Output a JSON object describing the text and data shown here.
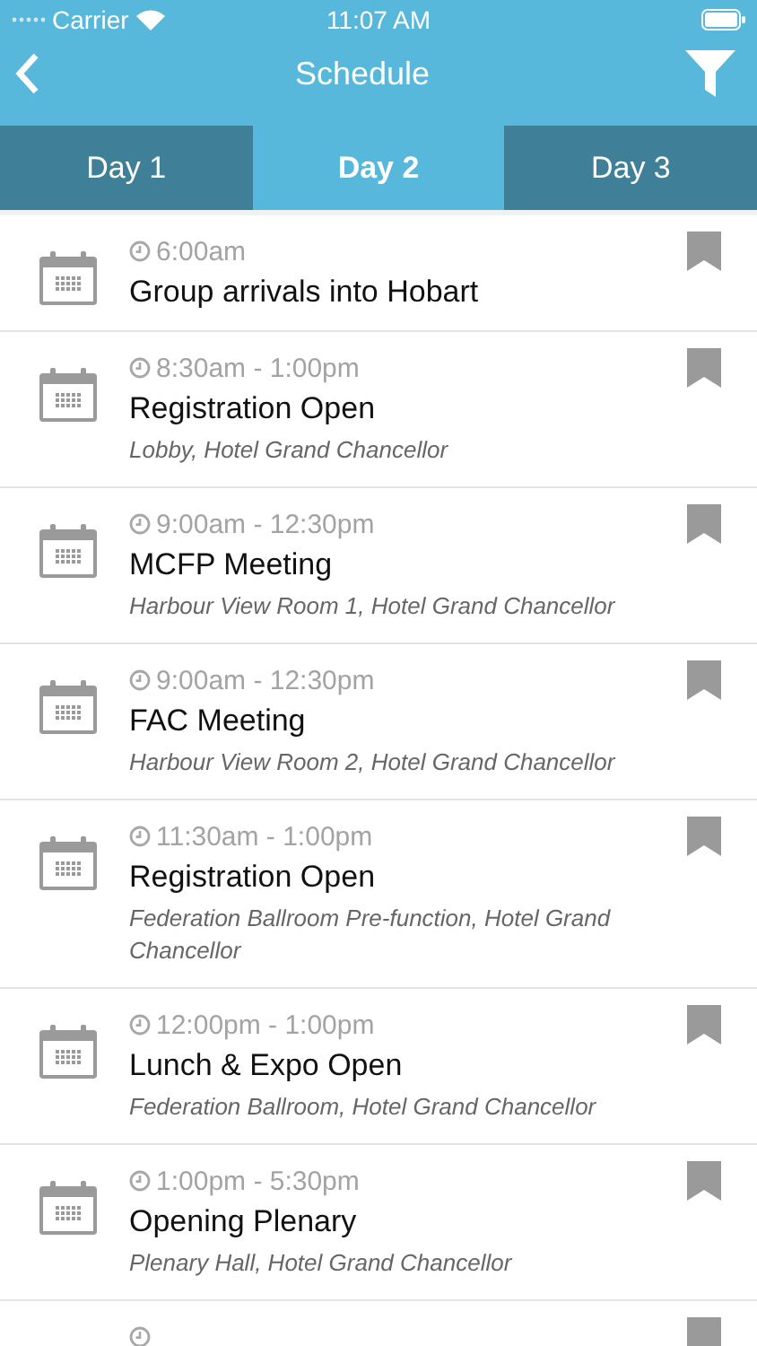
{
  "status_bar": {
    "carrier": "Carrier",
    "time": "11:07 AM"
  },
  "nav": {
    "title": "Schedule"
  },
  "tabs": [
    {
      "label": "Day 1",
      "selected": false
    },
    {
      "label": "Day 2",
      "selected": true
    },
    {
      "label": "Day 3",
      "selected": false
    }
  ],
  "sessions": [
    {
      "time": "6:00am",
      "title": "Group arrivals into Hobart",
      "bookmarked": false
    },
    {
      "time": "8:30am - 1:00pm",
      "title": "Registration Open",
      "location": "Lobby, Hotel Grand Chancellor",
      "bookmarked": false
    },
    {
      "time": "9:00am - 12:30pm",
      "title": "MCFP Meeting",
      "location": "Harbour View Room 1, Hotel Grand Chancellor",
      "bookmarked": false
    },
    {
      "time": "9:00am - 12:30pm",
      "title": "FAC Meeting",
      "location": "Harbour View Room 2, Hotel Grand Chancellor",
      "bookmarked": false
    },
    {
      "time": "11:30am - 1:00pm",
      "title": "Registration Open",
      "location": "Federation Ballroom Pre-function, Hotel Grand Chancellor",
      "bookmarked": false
    },
    {
      "time": "12:00pm - 1:00pm",
      "title": "Lunch & Expo Open",
      "location": "Federation Ballroom, Hotel Grand Chancellor",
      "bookmarked": false
    },
    {
      "time": "1:00pm - 5:30pm",
      "title": "Opening Plenary",
      "location": "Plenary Hall, Hotel Grand Chancellor",
      "bookmarked": false
    },
    {
      "kind": "partial",
      "bookmarked": false
    }
  ]
}
